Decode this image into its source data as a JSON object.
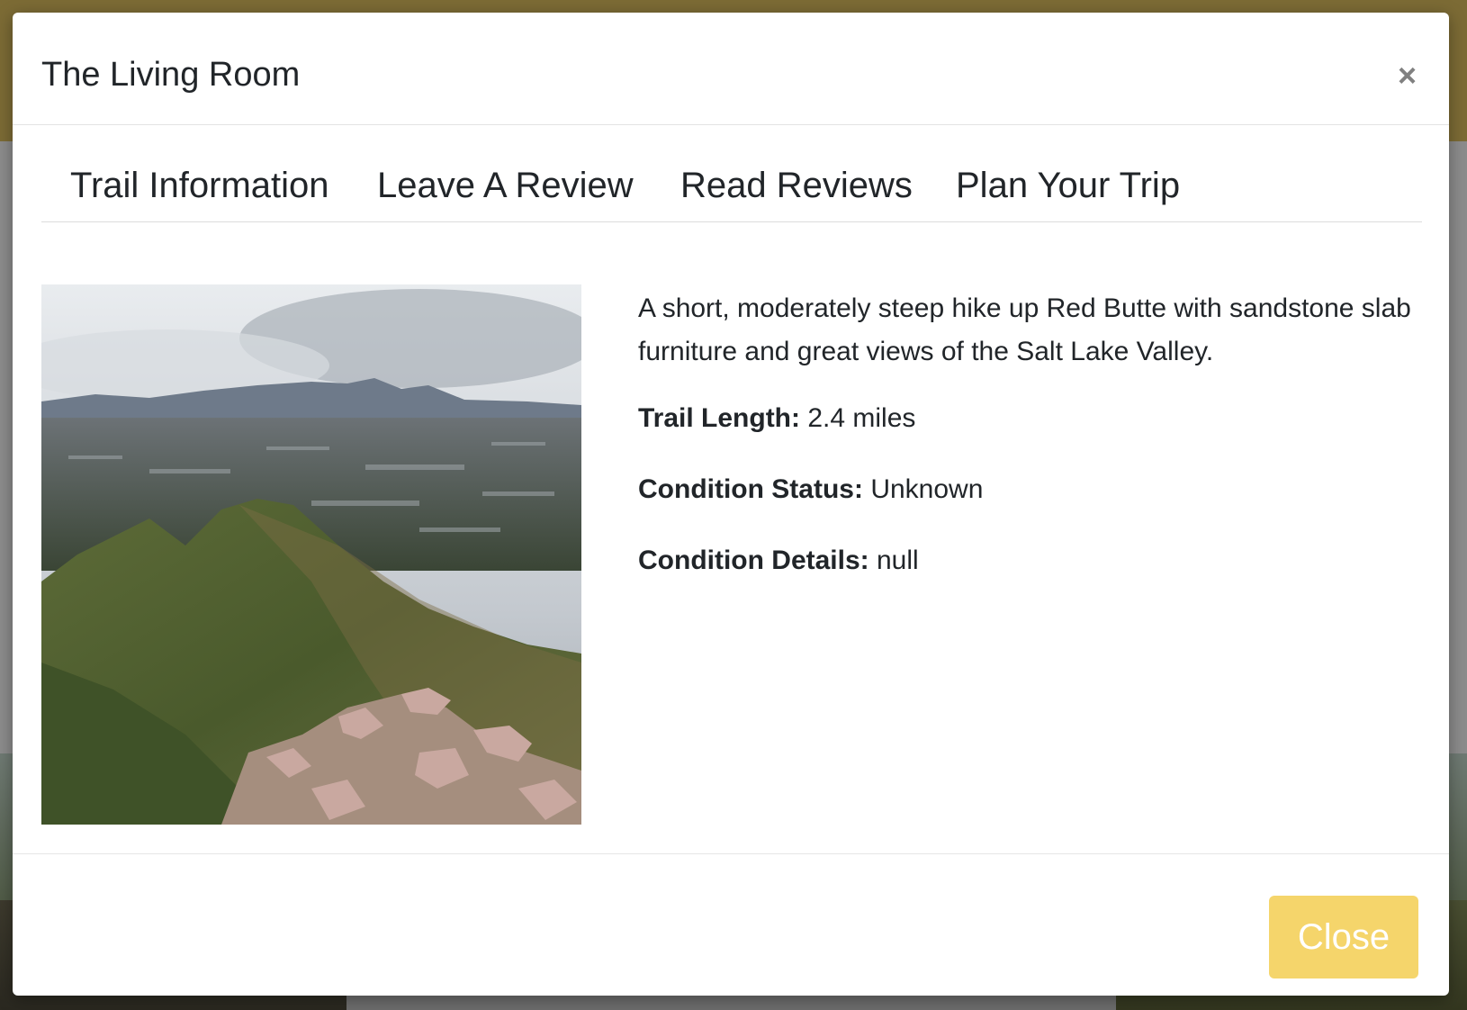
{
  "modal": {
    "title": "The Living Room",
    "close_symbol": "×",
    "close_icon": "close-icon"
  },
  "tabs": [
    {
      "label": "Trail Information"
    },
    {
      "label": "Leave A Review"
    },
    {
      "label": "Read Reviews"
    },
    {
      "label": "Plan Your Trip"
    }
  ],
  "trail": {
    "image_name": "trail-photo",
    "description": "A short, moderately steep hike up Red Butte with sandstone slab furniture and great views of the Salt Lake Valley.",
    "length_label": "Trail Length:",
    "length_value": "2.4 miles",
    "condition_status_label": "Condition Status:",
    "condition_status_value": "Unknown",
    "condition_details_label": "Condition Details:",
    "condition_details_value": "null"
  },
  "footer": {
    "close_label": "Close"
  },
  "colors": {
    "close_button_bg": "#f5d56b",
    "header_band": "#7c6b35",
    "text": "#212529"
  }
}
